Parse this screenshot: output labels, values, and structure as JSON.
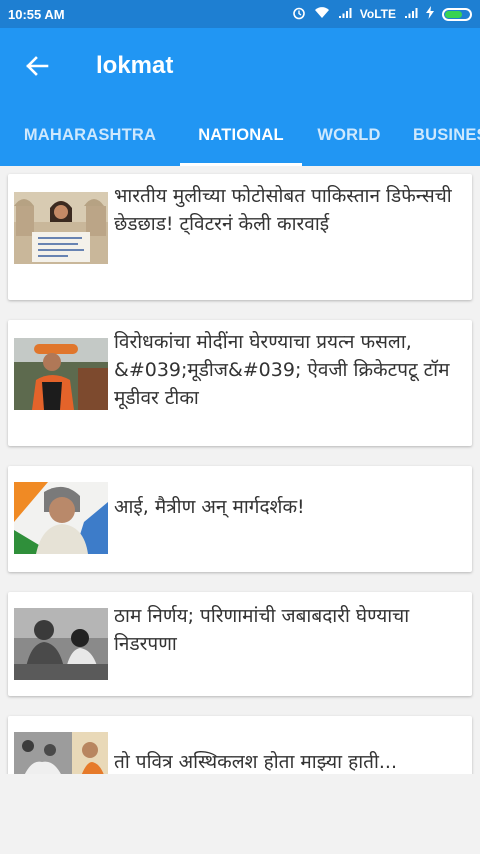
{
  "status_bar": {
    "time": "10:55 AM",
    "network": "VoLTE",
    "icons": [
      "alarm-icon",
      "wifi-icon",
      "signal-icon",
      "signal-icon",
      "charging-icon",
      "battery-icon"
    ]
  },
  "app_bar": {
    "back_icon": "arrow-left-icon",
    "title": "lokmat"
  },
  "tabs": [
    {
      "label": "MAHARASHTRA",
      "selected": false
    },
    {
      "label": "NATIONAL",
      "selected": true
    },
    {
      "label": "WORLD",
      "selected": false
    },
    {
      "label": "BUSINES",
      "selected": false
    }
  ],
  "articles": [
    {
      "headline": "भारतीय मुलीच्या फोटोसोबत पाकिस्तान डिफेन्सची छेडछाड! ट्विटरनं केली कारवाई"
    },
    {
      "headline": "विरोधकांचा मोदींना घेरण्याचा प्रयत्न फसला, &#039;मूडीज&#039; ऐवजी क्रिकेटपटू टॉम मूडीवर टीका"
    },
    {
      "headline": "आई, मैत्रीण अन् मार्गदर्शक!"
    },
    {
      "headline": "ठाम निर्णय; परिणामांची जबाबदारी घेण्याचा निडरपणा"
    },
    {
      "headline": "तो पवित्र अस्थिकलश होता माझ्या हाती..."
    }
  ],
  "colors": {
    "status_bar": "#1e7fd2",
    "app_bar": "#2196f3",
    "background": "#f2f2f2",
    "card": "#ffffff",
    "headline_text": "#333333"
  }
}
